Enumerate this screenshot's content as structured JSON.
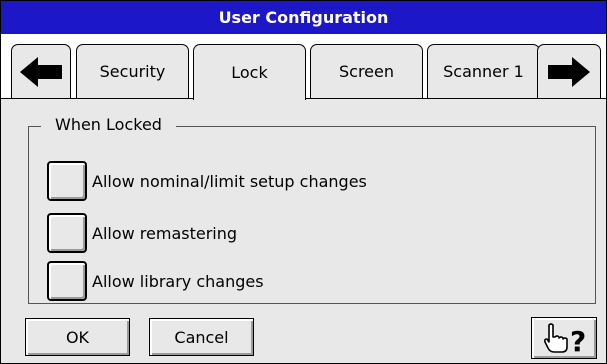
{
  "window": {
    "title": "User Configuration"
  },
  "tabs": [
    {
      "label": "Security",
      "active": false
    },
    {
      "label": "Lock",
      "active": true
    },
    {
      "label": "Screen",
      "active": false
    },
    {
      "label": "Scanner 1",
      "active": false
    }
  ],
  "nav": {
    "prev_icon": "arrow-left-icon",
    "next_icon": "arrow-right-icon"
  },
  "group": {
    "title": "When Locked",
    "options": [
      {
        "label": "Allow nominal/limit setup changes",
        "checked": false
      },
      {
        "label": "Allow remastering",
        "checked": false
      },
      {
        "label": "Allow library changes",
        "checked": false
      }
    ]
  },
  "buttons": {
    "ok_label": "OK",
    "cancel_label": "Cancel",
    "help_icon": "pointing-hand-help-icon"
  },
  "colors": {
    "title_bar": "#1c18c8",
    "title_text": "#ffffff",
    "panel": "#e8e8e8"
  }
}
